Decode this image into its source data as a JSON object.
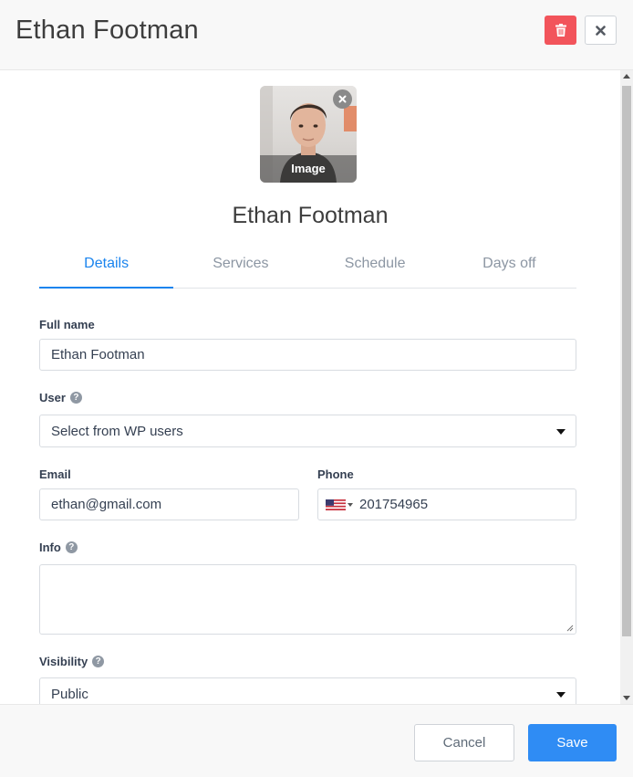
{
  "header": {
    "title": "Ethan Footman",
    "delete_icon": "trash-icon",
    "close_icon": "close-icon"
  },
  "avatar": {
    "caption": "Image",
    "remove_icon": "close-circle-icon"
  },
  "profile": {
    "name": "Ethan Footman"
  },
  "tabs": [
    {
      "label": "Details",
      "active": true
    },
    {
      "label": "Services",
      "active": false
    },
    {
      "label": "Schedule",
      "active": false
    },
    {
      "label": "Days off",
      "active": false
    }
  ],
  "form": {
    "full_name": {
      "label": "Full name",
      "value": "Ethan Footman"
    },
    "user": {
      "label": "User",
      "value": "Select from WP users",
      "help_icon": "question-circle-icon"
    },
    "email": {
      "label": "Email",
      "value": "ethan@gmail.com"
    },
    "phone": {
      "label": "Phone",
      "value": "201754965",
      "flag_icon": "us-flag-icon"
    },
    "info": {
      "label": "Info",
      "value": "",
      "help_icon": "question-circle-icon"
    },
    "visibility": {
      "label": "Visibility",
      "value": "Public",
      "help_icon": "question-circle-icon"
    }
  },
  "footer": {
    "cancel_label": "Cancel",
    "save_label": "Save"
  },
  "colors": {
    "accent": "#1a84ee",
    "save_button": "#2f8cf4",
    "delete_button": "#f2545b"
  }
}
